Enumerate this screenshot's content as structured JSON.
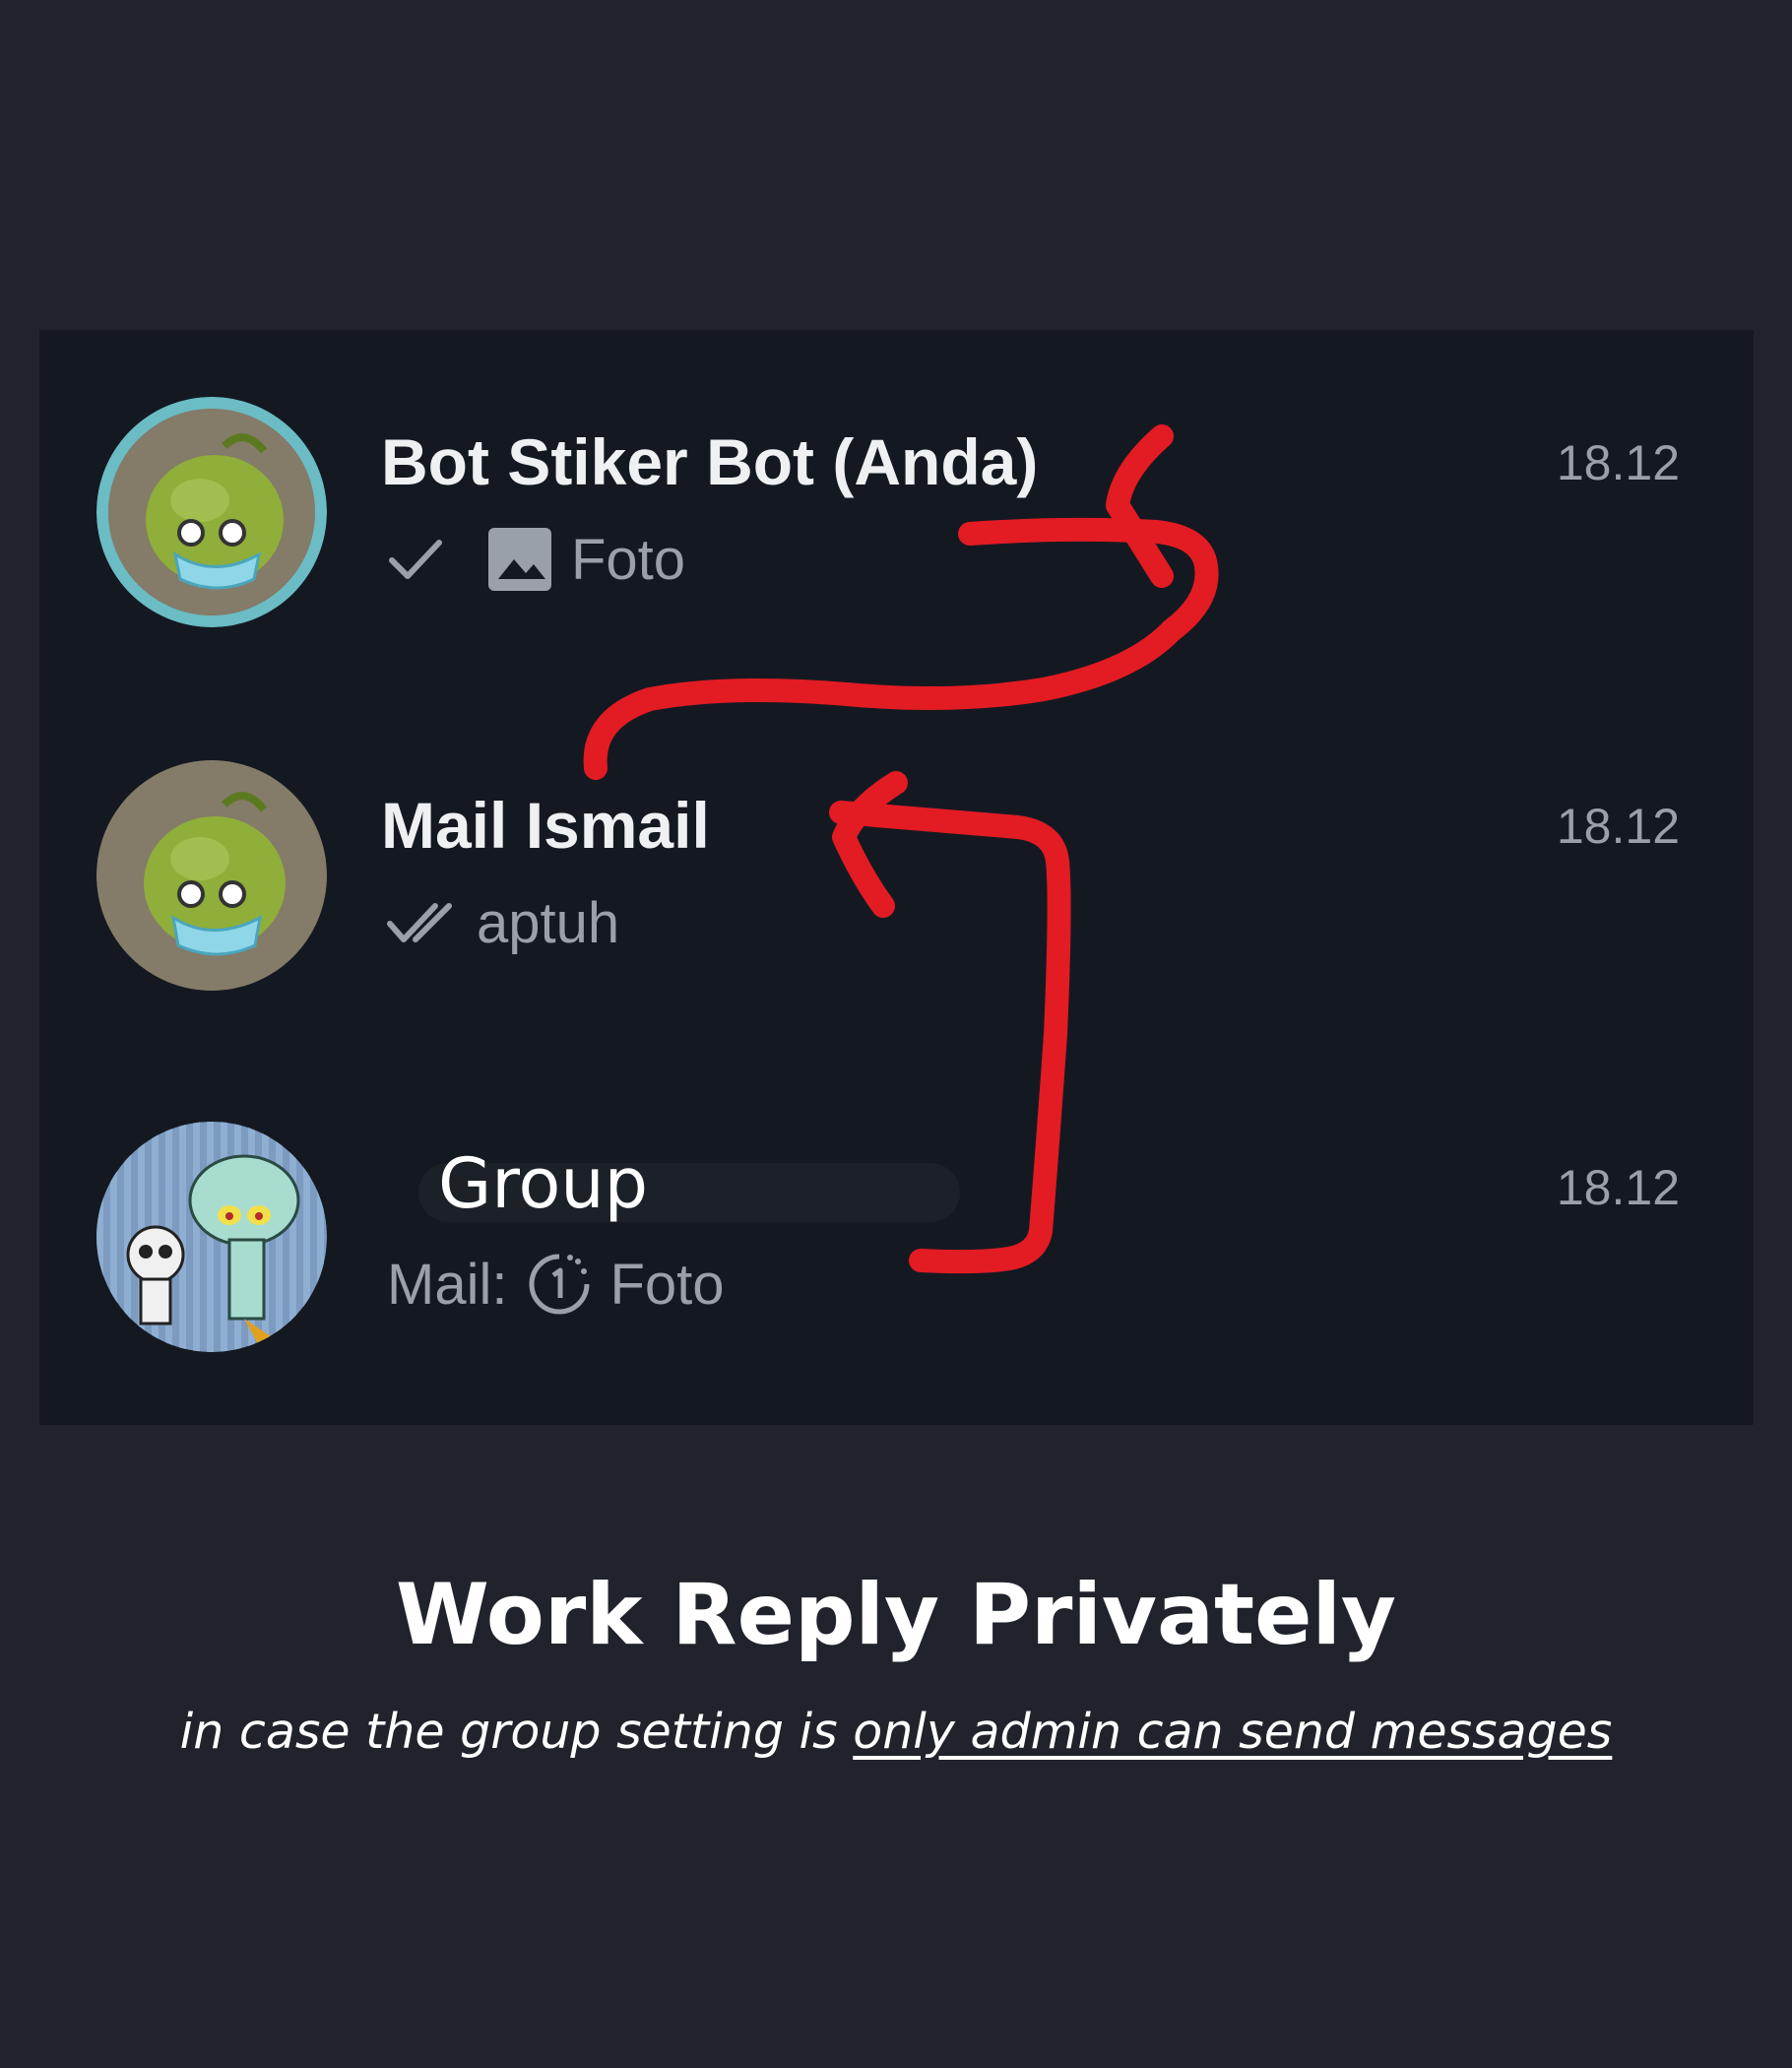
{
  "chats": [
    {
      "name": "Bot Stiker Bot (Anda)",
      "time": "18.12",
      "status_icon": "single-check-icon",
      "media_icon": "photo-icon",
      "preview": "Foto"
    },
    {
      "name": "Mail Ismail",
      "time": "18.12",
      "status_icon": "double-check-icon",
      "preview": "aptuh"
    },
    {
      "name": "Group",
      "time": "18.12",
      "sender": "Mail:",
      "media_icon": "view-once-icon",
      "preview": "Foto"
    }
  ],
  "annotation": {
    "arrow_color": "#e31b23"
  },
  "footer": {
    "headline": "Work Reply Privately",
    "subline_prefix": "in case the group setting is",
    "subline_emphasis": "only admin can send messages"
  }
}
